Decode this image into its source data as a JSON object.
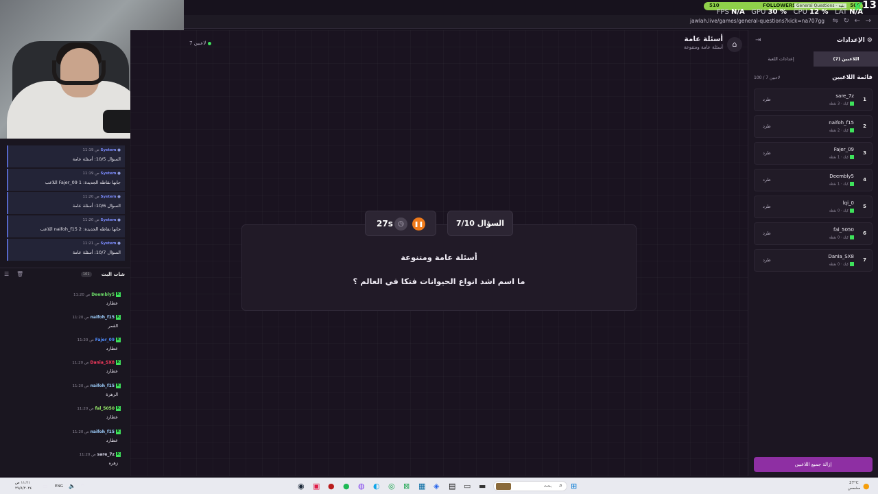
{
  "overlay": {
    "followers_goal_current": "510",
    "followers_label": "FOLLOWERS",
    "followers_sub": "General Questions - بثية",
    "followers_target": "500",
    "counter": "13",
    "logo": "K",
    "stats": {
      "fps_label": "FPS",
      "fps": "N/A",
      "gpu_label": "GPU",
      "gpu": "30 %",
      "cpu_label": "CPU",
      "cpu": "12 %",
      "lat_label": "LAT",
      "lat": "N/A"
    }
  },
  "browser": {
    "url": "jawlah.live/games/general-questions?kick=na707gg"
  },
  "system_feed": [
    {
      "sender": "System",
      "time": "11:19 ص",
      "text": "السؤال 10/5: أسئلة عامة"
    },
    {
      "sender": "System",
      "time": "11:19 ص",
      "text": "اللاعب Fajer_09 جابها نقاطه الجديدة: 1"
    },
    {
      "sender": "System",
      "time": "11:20 ص",
      "text": "السؤال 10/6: أسئلة عامة"
    },
    {
      "sender": "System",
      "time": "11:20 ص",
      "text": "اللاعب naifoh_f15 جابها نقاطه الجديدة: 2"
    },
    {
      "sender": "System",
      "time": "11:21 ص",
      "text": "السؤال 10/7: أسئلة عامة"
    }
  ],
  "chat": {
    "title": "شات البث",
    "count": "101",
    "messages": [
      {
        "user": "Deembly5",
        "time": "11:20 ص",
        "color": "#6fe36b",
        "text": "عطارد"
      },
      {
        "user": "naifoh_f15",
        "time": "11:20 ص",
        "color": "#9fd0ff",
        "text": "القمر"
      },
      {
        "user": "Fajer_09",
        "time": "11:20 ص",
        "color": "#4f8dff",
        "text": "عطارد"
      },
      {
        "user": "Dania_SX8",
        "time": "11:20 ص",
        "color": "#ff3b5f",
        "text": "عطارد"
      },
      {
        "user": "naifoh_f15",
        "time": "11:20 ص",
        "color": "#9fd0ff",
        "text": "الزهرة"
      },
      {
        "user": "fal_5050",
        "time": "11:20 ص",
        "color": "#9af06b",
        "text": "عطارد"
      },
      {
        "user": "naifoh_f15",
        "time": "11:20 ص",
        "color": "#9fd0ff",
        "text": "عطارد"
      },
      {
        "user": "sare_7z",
        "time": "11:20 ص",
        "color": "#d8d8e8",
        "text": "زهره"
      }
    ]
  },
  "game": {
    "players_online": "7 لاعبين",
    "title": "أسئلة عامة",
    "subtitle": "أسئلة عامة ومتنوعة",
    "timer": "27s",
    "question_number": "السؤال 7/10",
    "category": "أسئلة عامة ومتنوعة",
    "question": "ما اسم اشد انواع الحيوانات فتكا في العالم ؟"
  },
  "settings": {
    "header": "الإعدادات",
    "tab_players": "اللاعبين (7)",
    "tab_game": "إعدادات اللعبة",
    "list_title": "قائمة اللاعبين",
    "list_count": "100 / 7 لاعبين",
    "kick_label": "طرد",
    "remove_all": "إزالة جميع اللاعبين",
    "players": [
      {
        "rank": "1",
        "name": "sare_7z",
        "points": "كيك · 3 نقطة"
      },
      {
        "rank": "2",
        "name": "naifoh_f15",
        "points": "كيك · 2 نقطة"
      },
      {
        "rank": "3",
        "name": "Fajer_09",
        "points": "كيك · 1 نقطة"
      },
      {
        "rank": "4",
        "name": "Deembly5",
        "points": "كيك · 1 نقطة"
      },
      {
        "rank": "5",
        "name": "lqi_0",
        "points": "كيك · 0 نقطة"
      },
      {
        "rank": "6",
        "name": "fal_5050",
        "points": "كيك · 0 نقطة"
      },
      {
        "rank": "7",
        "name": "Dania_SX8",
        "points": "كيك · 0 نقطة"
      }
    ]
  },
  "taskbar": {
    "time": "١١:٢١ ص",
    "date": "٢٧/٨/٢٠٢٤",
    "lang": "ENG",
    "weather": "27°C",
    "weather_sub": "مشمس",
    "search_placeholder": "بحث"
  }
}
